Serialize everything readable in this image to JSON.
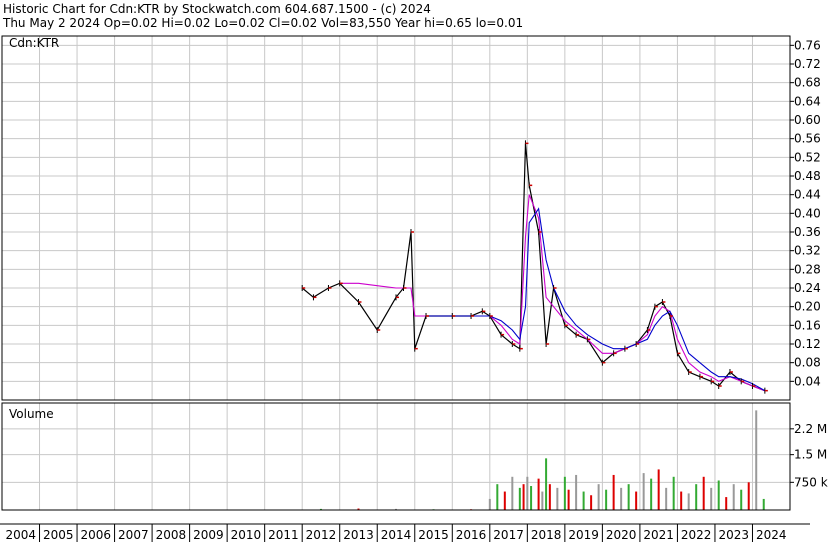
{
  "header": {
    "title": "Historic Chart for Cdn:KTR by Stockwatch.com 604.687.1500 - (c) 2024",
    "stats": "Thu May  2 2024  Op=0.02  Hi=0.02  Lo=0.02  Cl=0.02  Vol=83,550  Year hi=0.65  lo=0.01"
  },
  "colors": {
    "bars": "#000000",
    "limit_ticks": "#cc0000",
    "ma_short": "#cc00cc",
    "ma_long": "#0000cc",
    "grid": "#c8c8c8",
    "vol_up": "#33aa33",
    "vol_down": "#dd0000",
    "vol_flat": "#999999"
  },
  "chart_data": [
    {
      "type": "line",
      "title": "Cdn:KTR",
      "x": [
        "2012",
        "2012.3",
        "2012.7",
        "2013",
        "2013.5",
        "2014",
        "2014.5",
        "2014.7",
        "2014.9",
        "2015",
        "2015.3",
        "2016",
        "2016.5",
        "2016.8",
        "2017",
        "2017.3",
        "2017.6",
        "2017.8",
        "2017.95",
        "2018.05",
        "2018.3",
        "2018.5",
        "2018.7",
        "2019",
        "2019.3",
        "2019.6",
        "2020",
        "2020.3",
        "2020.6",
        "2020.9",
        "2021.2",
        "2021.4",
        "2021.6",
        "2021.8",
        "2022",
        "2022.3",
        "2022.6",
        "2022.9",
        "2023.1",
        "2023.4",
        "2023.7",
        "2024",
        "2024.33"
      ],
      "series": [
        {
          "values": [
            0.24,
            0.22,
            0.24,
            0.25,
            0.21,
            0.15,
            0.22,
            0.24,
            0.36,
            0.11,
            0.18,
            0.18,
            0.18,
            0.19,
            0.18,
            0.14,
            0.12,
            0.11,
            0.55,
            0.46,
            0.36,
            0.12,
            0.24,
            0.16,
            0.14,
            0.13,
            0.08,
            0.1,
            0.11,
            0.12,
            0.15,
            0.2,
            0.21,
            0.18,
            0.1,
            0.06,
            0.05,
            0.04,
            0.03,
            0.06,
            0.04,
            0.03,
            0.02
          ]
        },
        {
          "values": [
            null,
            null,
            null,
            0.25,
            0.25,
            0.245,
            0.24,
            0.24,
            0.24,
            0.18,
            0.18,
            0.18,
            0.18,
            0.18,
            0.18,
            0.16,
            0.13,
            0.12,
            0.35,
            0.44,
            0.39,
            0.22,
            0.2,
            0.17,
            0.15,
            0.13,
            0.1,
            0.1,
            0.11,
            0.12,
            0.14,
            0.18,
            0.2,
            0.19,
            0.13,
            0.08,
            0.06,
            0.05,
            0.04,
            0.05,
            0.04,
            0.03,
            0.02
          ]
        },
        {
          "values": [
            null,
            null,
            null,
            null,
            null,
            null,
            null,
            null,
            null,
            null,
            0.18,
            0.18,
            0.18,
            0.18,
            0.18,
            0.17,
            0.15,
            0.13,
            0.2,
            0.38,
            0.41,
            0.3,
            0.24,
            0.19,
            0.16,
            0.14,
            0.12,
            0.11,
            0.11,
            0.12,
            0.13,
            0.16,
            0.18,
            0.19,
            0.16,
            0.1,
            0.08,
            0.06,
            0.05,
            0.05,
            0.045,
            0.035,
            0.02
          ]
        }
      ],
      "ylim": [
        0,
        0.78
      ],
      "yticks": [
        0.04,
        0.08,
        0.12,
        0.16,
        0.2,
        0.24,
        0.28,
        0.32,
        0.36,
        0.4,
        0.44,
        0.48,
        0.52,
        0.56,
        0.6,
        0.64,
        0.68,
        0.72,
        0.76
      ],
      "ytick_labels": [
        "0.04",
        "0.08",
        "0.12",
        "0.16",
        "0.20",
        "0.24",
        "0.28",
        "0.32",
        "0.36",
        "0.40",
        "0.44",
        "0.48",
        "0.52",
        "0.56",
        "0.60",
        "0.64",
        "0.68",
        "0.72",
        "0.76"
      ],
      "grid": true
    },
    {
      "type": "bar",
      "title": "Volume",
      "x": [
        "2012.5",
        "2013.5",
        "2014.5",
        "2015.5",
        "2016.5",
        "2017.0",
        "2017.2",
        "2017.4",
        "2017.6",
        "2017.8",
        "2017.9",
        "2018.0",
        "2018.1",
        "2018.3",
        "2018.4",
        "2018.5",
        "2018.6",
        "2018.8",
        "2019.0",
        "2019.1",
        "2019.3",
        "2019.5",
        "2019.7",
        "2019.9",
        "2020.1",
        "2020.3",
        "2020.5",
        "2020.7",
        "2020.9",
        "2021.1",
        "2021.3",
        "2021.5",
        "2021.7",
        "2021.9",
        "2022.1",
        "2022.3",
        "2022.5",
        "2022.7",
        "2022.9",
        "2023.1",
        "2023.3",
        "2023.5",
        "2023.7",
        "2023.9",
        "2024.1",
        "2024.3"
      ],
      "values": [
        30000,
        40000,
        30000,
        20000,
        20000,
        300000,
        700000,
        500000,
        900000,
        600000,
        700000,
        900000,
        650000,
        850000,
        500000,
        1400000,
        700000,
        600000,
        900000,
        550000,
        950000,
        500000,
        400000,
        700000,
        550000,
        950000,
        600000,
        700000,
        500000,
        1000000,
        850000,
        1100000,
        600000,
        900000,
        500000,
        450000,
        700000,
        900000,
        600000,
        800000,
        350000,
        700000,
        550000,
        750000,
        2700000,
        300000
      ],
      "ylim": [
        0,
        2900000
      ],
      "yticks": [
        750000,
        1500000,
        2200000
      ],
      "ytick_labels": [
        "750 k",
        "1.5 M",
        "2.2 M"
      ],
      "grid": true
    }
  ],
  "xaxis": {
    "years": [
      "2004",
      "2005",
      "2006",
      "2007",
      "2008",
      "2009",
      "2010",
      "2011",
      "2012",
      "2013",
      "2014",
      "2015",
      "2016",
      "2017",
      "2018",
      "2019",
      "2020",
      "2021",
      "2022",
      "2023",
      "2024"
    ]
  }
}
